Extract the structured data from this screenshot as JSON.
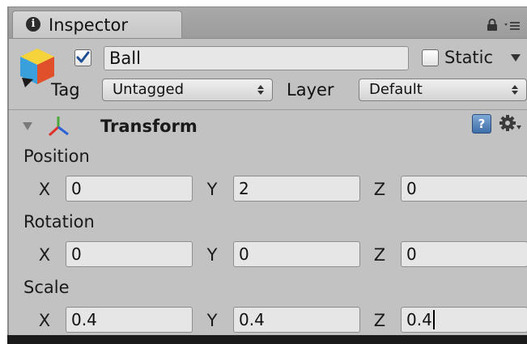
{
  "tab": {
    "label": "Inspector",
    "icon": "info-icon"
  },
  "toolbar_icons": [
    "lock-icon",
    "menu-icon"
  ],
  "object": {
    "icon": "gameobject-cube-icon",
    "active_checked": true,
    "name": "Ball",
    "static_checked": false,
    "static_label": "Static"
  },
  "tag": {
    "label": "Tag",
    "value": "Untagged"
  },
  "layer": {
    "label": "Layer",
    "value": "Default"
  },
  "component": {
    "title": "Transform",
    "expanded": true,
    "icons": [
      "transform-icon",
      "help-icon",
      "settings-icon"
    ],
    "help_glyph": "?"
  },
  "transform": {
    "position": {
      "label": "Position",
      "x_label": "X",
      "y_label": "Y",
      "z_label": "Z",
      "x": "0",
      "y": "2",
      "z": "0"
    },
    "rotation": {
      "label": "Rotation",
      "x_label": "X",
      "y_label": "Y",
      "z_label": "Z",
      "x": "0",
      "y": "0",
      "z": "0"
    },
    "scale": {
      "label": "Scale",
      "x_label": "X",
      "y_label": "Y",
      "z_label": "Z",
      "x": "0.4",
      "y": "0.4",
      "z": "0.4"
    }
  },
  "focused_field": "scale-z",
  "colors": {
    "panel_bg": "#c2c2c2",
    "field_bg": "#e6e6e6",
    "checkbox_check": "#1f4e95",
    "axis_x": "#e0302a",
    "axis_y": "#4aa83a",
    "axis_z": "#2c62d8"
  }
}
